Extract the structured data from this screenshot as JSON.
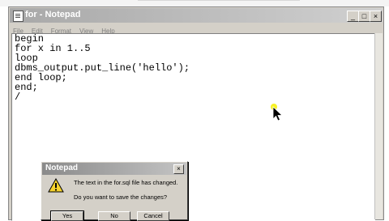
{
  "window": {
    "title": "for - Notepad",
    "minimize_glyph": "_",
    "maximize_glyph": "□",
    "close_glyph": "×"
  },
  "menu": {
    "items": [
      {
        "label": "File"
      },
      {
        "label": "Edit"
      },
      {
        "label": "Format"
      },
      {
        "label": "View"
      },
      {
        "label": "Help"
      }
    ]
  },
  "editor": {
    "lines": [
      "begin",
      "for x in 1..5",
      "loop",
      "dbms_output.put_line('hello');",
      "end loop;",
      "end;",
      "/"
    ]
  },
  "dialog": {
    "title": "Notepad",
    "close_glyph": "×",
    "icon": "warning-icon",
    "message_line1": "The text in the for.sql file has changed.",
    "message_line2": "Do you want to save the changes?",
    "buttons": {
      "yes": "Yes",
      "no": "No",
      "cancel": "Cancel"
    }
  },
  "colors": {
    "warning_fill": "#f6d32d",
    "cursor_highlight": "#f6f000"
  }
}
